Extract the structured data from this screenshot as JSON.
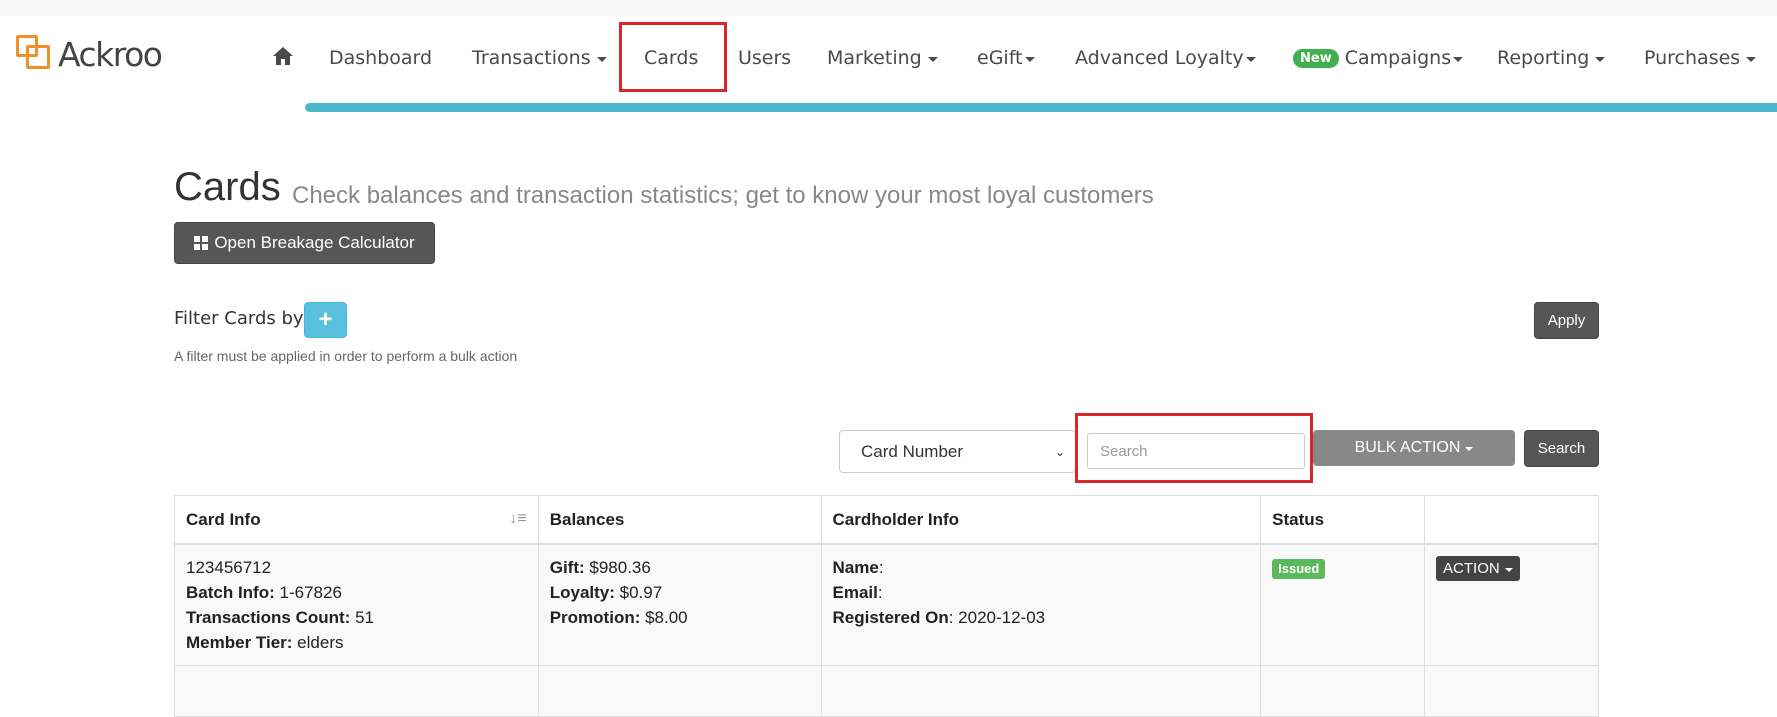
{
  "brand": {
    "name": "Ackroo",
    "accent": "#f0902a",
    "teal": "#4bb6c9"
  },
  "nav": {
    "home_icon": "home-icon",
    "items": [
      {
        "label": "Dashboard",
        "dropdown": false
      },
      {
        "label": "Transactions",
        "dropdown": true
      },
      {
        "label": "Cards",
        "dropdown": false
      },
      {
        "label": "Users",
        "dropdown": false
      },
      {
        "label": "Marketing",
        "dropdown": true
      },
      {
        "label": "eGift",
        "dropdown": true
      },
      {
        "label": "Advanced Loyalty",
        "dropdown": true
      },
      {
        "label": "Campaigns",
        "dropdown": true,
        "badge": "New"
      },
      {
        "label": "Reporting",
        "dropdown": true
      },
      {
        "label": "Purchases",
        "dropdown": true
      }
    ]
  },
  "page": {
    "title": "Cards",
    "subtitle": "Check balances and transaction statistics; get to know your most loyal customers",
    "breakage_button": "Open Breakage Calculator",
    "filter_label": "Filter Cards by",
    "apply_button": "Apply",
    "filter_note": "A filter must be applied in order to perform a bulk action"
  },
  "search": {
    "field_selected": "Card Number",
    "placeholder": "Search",
    "bulk_action": "BULK ACTION",
    "search_button": "Search"
  },
  "table": {
    "headers": [
      "Card Info",
      "Balances",
      "Cardholder Info",
      "Status",
      ""
    ],
    "rows": [
      {
        "card_number": "123456712",
        "batch_label": "Batch Info:",
        "batch_value": " 1-67826",
        "tx_label": "Transactions Count:",
        "tx_value": " 51",
        "tier_label": "Member Tier:",
        "tier_value": " elders",
        "gift_label": "Gift:",
        "gift_value": " $980.36",
        "loyalty_label": "Loyalty:",
        "loyalty_value": " $0.97",
        "promo_label": "Promotion:",
        "promo_value": " $8.00",
        "name_label": "Name",
        "name_value": ":",
        "email_label": "Email",
        "email_value": ":",
        "reg_label": "Registered On",
        "reg_value": ": 2020-12-03",
        "status": "Issued",
        "action": "ACTION"
      }
    ]
  },
  "colors": {
    "highlight": "#d9262c",
    "status_issued": "#5cb85c",
    "new_badge": "#3fae4e"
  }
}
